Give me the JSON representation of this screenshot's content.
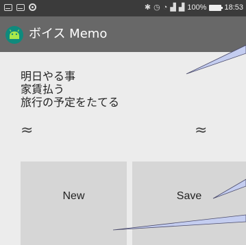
{
  "status_bar": {
    "battery_text": "100%",
    "time": "18:53",
    "icons": [
      "mail-icon",
      "mail-icon",
      "record-icon",
      "bluetooth-icon",
      "alarm-icon",
      "wifi-icon",
      "signal-icon",
      "signal-icon",
      "battery-icon"
    ]
  },
  "app_bar": {
    "title": "ボイス Memo",
    "icon": "android-icon",
    "color": "#686868"
  },
  "memo": {
    "lines": [
      "明日やる事",
      "家賃払う",
      "旅行の予定をたてる"
    ]
  },
  "wave_symbols": {
    "left": "≈",
    "right": "≈"
  },
  "buttons": {
    "new_label": "New",
    "save_label": "Save"
  }
}
